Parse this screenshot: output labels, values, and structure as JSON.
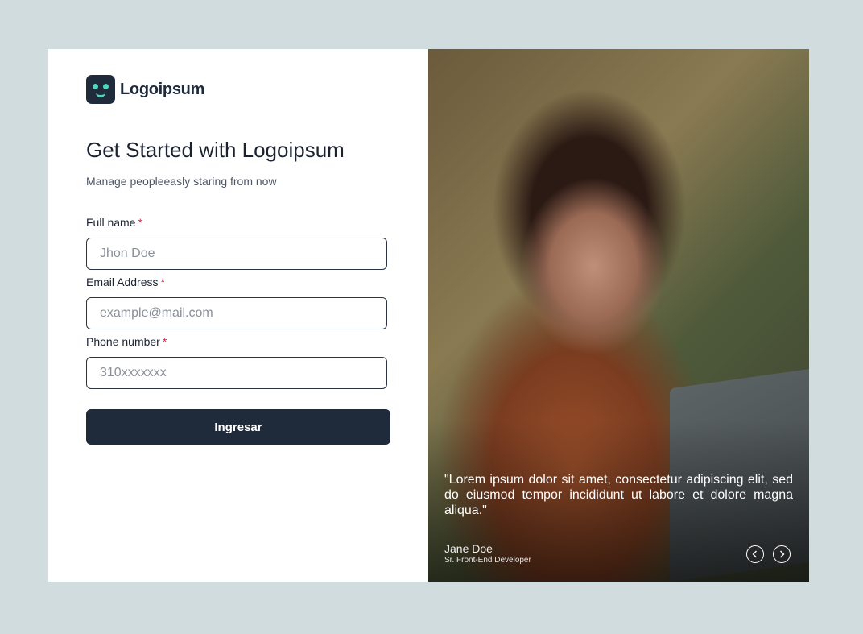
{
  "brand": {
    "name": "Logoipsum",
    "icon": "smiley-face-icon",
    "accent": "#4fd6bd",
    "color": "#1f2a3b"
  },
  "form": {
    "title": "Get Started with Logoipsum",
    "subtitle": "Manage peopleeasly staring from now",
    "fields": [
      {
        "label": "Full name",
        "required_mark": "*",
        "placeholder": "Jhon Doe",
        "value": ""
      },
      {
        "label": "Email Address",
        "required_mark": "*",
        "placeholder": "example@mail.com",
        "value": ""
      },
      {
        "label": "Phone number",
        "required_mark": "*",
        "placeholder": "310xxxxxxx",
        "value": ""
      }
    ],
    "submit_label": "Ingresar"
  },
  "testimonial": {
    "quote": "\"Lorem ipsum dolor sit amet, consectetur adipiscing elit, sed do eiusmod tempor incididunt ut labore et dolore magna aliqua.\"",
    "author": "Jane Doe",
    "role": "Sr. Front-End Developer",
    "prev_icon": "chevron-left-icon",
    "next_icon": "chevron-right-icon"
  },
  "colors": {
    "background": "#d1dcdf",
    "button": "#1f2a3b",
    "required": "#e11d48"
  }
}
